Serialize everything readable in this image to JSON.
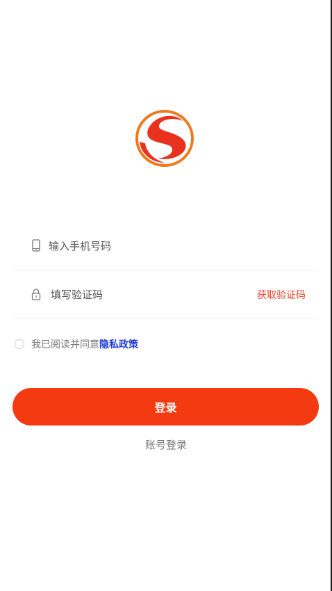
{
  "brand": {
    "logo_icon": "brand-s-logo-icon",
    "colors": {
      "red": "#e8321e",
      "orange": "#f07a1b"
    }
  },
  "form": {
    "phone": {
      "icon": "phone-icon",
      "placeholder": "输入手机号码",
      "value": ""
    },
    "code": {
      "icon": "lock-icon",
      "placeholder": "填写验证码",
      "value": "",
      "get_code_label": "获取验证码"
    }
  },
  "agreement": {
    "checked": false,
    "text": "我已阅读并同意",
    "link_text": "隐私政策"
  },
  "actions": {
    "login_label": "登录",
    "account_login_label": "账号登录"
  },
  "colors": {
    "primary": "#f43a10",
    "link": "#1f3dd8",
    "accent_text": "#e8462f"
  }
}
